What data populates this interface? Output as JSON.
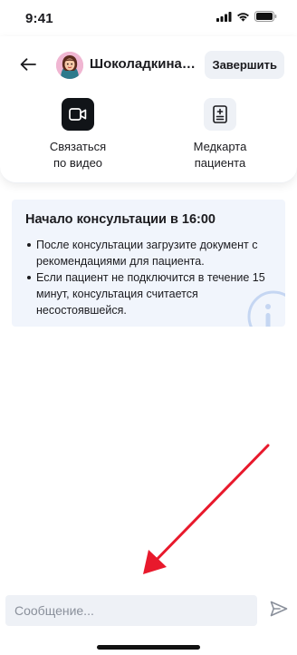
{
  "status_bar": {
    "time": "9:41"
  },
  "header": {
    "back_icon": "arrow-left-icon",
    "patient_name": "Шоколадкина ...",
    "finish_label": "Завершить"
  },
  "actions": [
    {
      "label": "Связаться\nпо видео",
      "icon": "video-camera-icon"
    },
    {
      "label": "Медкарта\nпациента",
      "icon": "medical-record-icon"
    }
  ],
  "info": {
    "title": "Начало консультации в 16:00",
    "items": [
      "После консультации загрузите документ с рекомендациями для пациента.",
      "Если пациент не подключится в течение 15 минут, консультация считается несостоявшейся."
    ],
    "icon": "info-icon"
  },
  "composer": {
    "placeholder": "Сообщение...",
    "send_icon": "send-icon"
  },
  "colors": {
    "accent_dark": "#111418",
    "info_bg": "#f1f5fc",
    "annotation_arrow": "#e8192c"
  }
}
